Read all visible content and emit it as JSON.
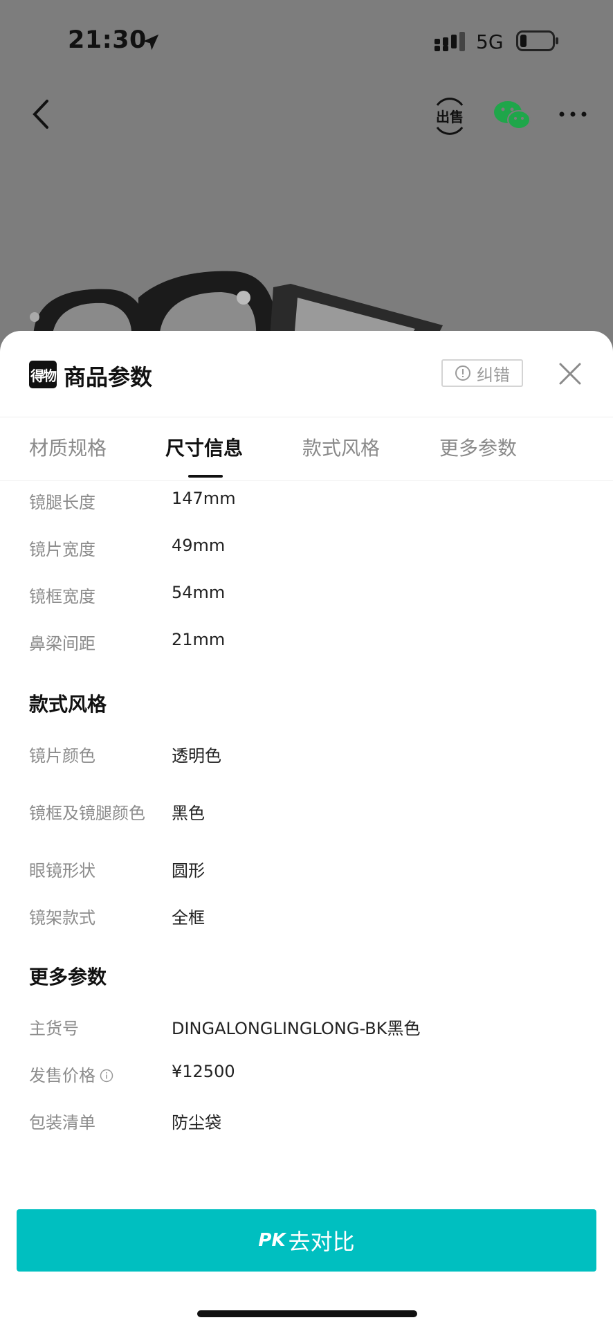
{
  "status_bar": {
    "time": "21:30",
    "network": "5G"
  },
  "icons": {
    "back": "chevron-left-icon",
    "sell": "sell-icon",
    "wechat": "wechat-icon",
    "more": "more-icon",
    "location": "location-arrow-icon",
    "signal": "signal-icon",
    "battery": "battery-icon",
    "close": "close-icon",
    "info": "info-icon"
  },
  "nav": {
    "sell_label": "出售"
  },
  "sheet": {
    "brand_logo": "得物",
    "title": "商品参数",
    "correction_label": "纠错"
  },
  "tabs": [
    {
      "label": "材质规格",
      "active": false
    },
    {
      "label": "尺寸信息",
      "active": true
    },
    {
      "label": "款式风格",
      "active": false
    },
    {
      "label": "更多参数",
      "active": false
    }
  ],
  "size_rows": [
    {
      "key": "镜腿长度",
      "value": "147mm"
    },
    {
      "key": "镜片宽度",
      "value": "49mm"
    },
    {
      "key": "镜框宽度",
      "value": "54mm"
    },
    {
      "key": "鼻梁间距",
      "value": "21mm"
    }
  ],
  "style_section": {
    "title": "款式风格",
    "rows": [
      {
        "key": "镜片颜色",
        "value": "透明色"
      },
      {
        "key": "镜框及镜腿颜色",
        "value": "黑色"
      },
      {
        "key": "眼镜形状",
        "value": "圆形"
      },
      {
        "key": "镜架款式",
        "value": "全框"
      }
    ]
  },
  "more_section": {
    "title": "更多参数",
    "rows": [
      {
        "key": "主货号",
        "value": "DINGALONGLINGLONG-BK黑色"
      },
      {
        "key": "发售价格",
        "value": "¥12500"
      },
      {
        "key": "包装清单",
        "value": "防尘袋"
      }
    ]
  },
  "pk_button": {
    "mark": "PK",
    "label": "去对比"
  },
  "colors": {
    "accent": "#00bfc0",
    "overlay": "#7d7d7d"
  }
}
